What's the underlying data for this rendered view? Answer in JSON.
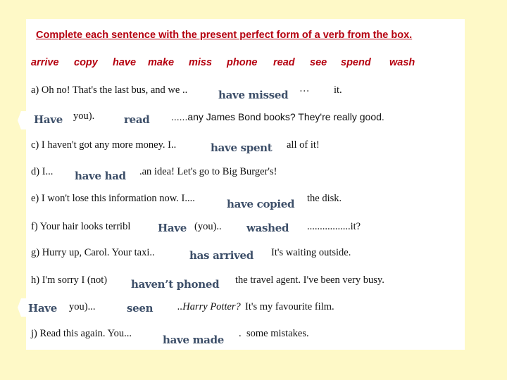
{
  "instruction": "Complete each sentence with the present perfect form of a verb from the box.",
  "word_box": [
    "arrive",
    "copy",
    "have",
    "make",
    "miss",
    "phone",
    "read",
    "see",
    "spend",
    "wash"
  ],
  "colors": {
    "background": "#fef9c7",
    "panel": "#ffffff",
    "instruction_and_words": "#b5000f",
    "answers": "#3d4f69",
    "sentence_text": "#111111"
  },
  "sentences": {
    "a": {
      "part1": "a)  Oh no! That's the last bus, and we ..",
      "answer": "have missed",
      "dots": "…",
      "part2": "it."
    },
    "b": {
      "answer1": "Have",
      "part1": "you).",
      "answer2": "read",
      "part2": "......any James Bond books? They're really good."
    },
    "c": {
      "part1": "c)  I haven't got any more money. I..",
      "answer": "have spent",
      "part2": "all of it!"
    },
    "d": {
      "part1": "d)  I...",
      "answer": "have had",
      "part2": ".an idea! Let's go to Big Burger's!"
    },
    "e": {
      "part1": "e)  I won't lose this information now. I....",
      "answer": "have copied",
      "part2": "the disk."
    },
    "f": {
      "part1": "f)  Your hair looks terribl",
      "answer1": "Have",
      "part2": "(you)..",
      "answer2": "washed",
      "part3": ".................it?"
    },
    "g": {
      "part1": "g)  Hurry up, Carol. Your taxi..",
      "answer": "has arrived",
      "part2": "It's waiting outside."
    },
    "h": {
      "part1": "h) I'm sorry I (not)",
      "answer": "haven’t phoned",
      "part2": "the travel agent. I've been very busy."
    },
    "i": {
      "answer1": "Have",
      "part1": "you)...",
      "answer2": "seen",
      "part2_italic": "..Harry Potter?",
      "part3": "It's my favourite film."
    },
    "j": {
      "part1": "j)   Read this again. You...",
      "answer": "have made",
      "dot": ".",
      "part2": "some mistakes."
    }
  }
}
